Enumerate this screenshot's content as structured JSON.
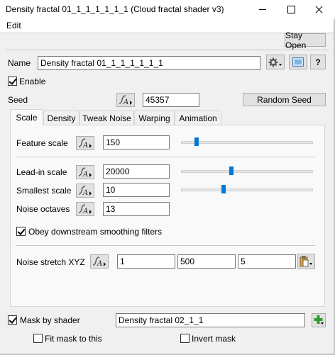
{
  "window": {
    "title": "Density fractal 01_1_1_1_1_1_1   (Cloud fractal shader v3)"
  },
  "menu": {
    "edit": "Edit"
  },
  "toolbar": {
    "stay_open": "Stay Open"
  },
  "name_row": {
    "label": "Name",
    "value": "Density fractal 01_1_1_1_1_1_1",
    "help": "?"
  },
  "enable": {
    "label": "Enable",
    "checked": true
  },
  "seed": {
    "label": "Seed",
    "value": "45357",
    "random_button": "Random Seed"
  },
  "tabs": [
    {
      "label": "Scale",
      "active": true
    },
    {
      "label": "Density"
    },
    {
      "label": "Tweak Noise"
    },
    {
      "label": "Warping"
    },
    {
      "label": "Animation"
    }
  ],
  "scale_tab": {
    "feature_scale": {
      "label": "Feature scale",
      "value": "150",
      "slider_level": 0.12
    },
    "lead_in_scale": {
      "label": "Lead-in scale",
      "value": "20000",
      "slider_level": 0.38
    },
    "smallest_scale": {
      "label": "Smallest scale",
      "value": "10",
      "slider_level": 0.32
    },
    "noise_octaves": {
      "label": "Noise octaves",
      "value": "13"
    },
    "obey_smoothing": {
      "label": "Obey downstream smoothing filters",
      "checked": true
    },
    "noise_stretch": {
      "label": "Noise stretch XYZ",
      "x": "1",
      "y": "500",
      "z": "5"
    }
  },
  "mask": {
    "mask_by_shader": {
      "label": "Mask by shader",
      "checked": true,
      "value": "Density fractal 02_1_1"
    },
    "fit_mask": {
      "label": "Fit mask to this",
      "checked": false
    },
    "invert_mask": {
      "label": "Invert mask",
      "checked": false
    }
  },
  "colors": {
    "accent": "#0078d7",
    "add_green": "#2e9e2e"
  }
}
